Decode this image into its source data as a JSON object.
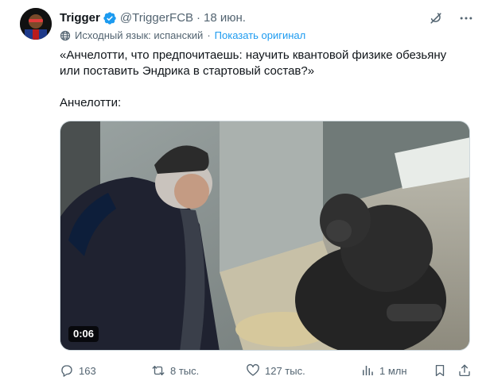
{
  "tweet": {
    "author_name": "Trigger",
    "handle": "@TriggerFCB",
    "separator": "·",
    "date": "18 июн.",
    "translation_note": "Исходный язык: испанский",
    "translation_separator": "·",
    "show_original_label": "Показать оригинал",
    "text_line_1": "«Анчелотти, что предпочитаешь: научить квантовой физике обезьяну или поставить Эндрика в стартовый состав?»",
    "text_line_2": "Анчелотти:",
    "video_duration": "0:06"
  },
  "actions": {
    "replies": "163",
    "retweets": "8 тыс.",
    "likes": "127 тыс.",
    "views": "1 млн"
  },
  "icons": {
    "verified": "verified-badge-icon",
    "grok": "grok-icon",
    "more": "more-icon",
    "globe": "globe-icon",
    "reply": "reply-icon",
    "retweet": "retweet-icon",
    "like": "heart-icon",
    "views": "views-icon",
    "bookmark": "bookmark-icon",
    "share": "share-icon"
  },
  "colors": {
    "accent": "#1d9bf0",
    "text_primary": "#0f1419",
    "text_secondary": "#536471"
  }
}
